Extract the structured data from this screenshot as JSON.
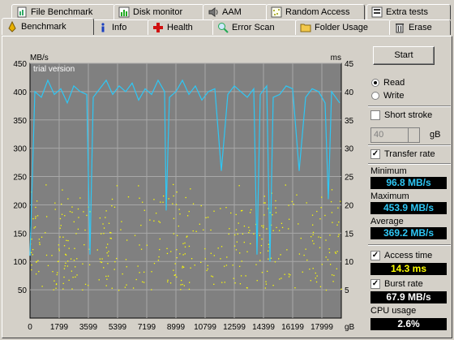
{
  "tabs_top": [
    {
      "label": "File Benchmark",
      "icon": "file-benchmark-icon"
    },
    {
      "label": "Disk monitor",
      "icon": "disk-monitor-icon"
    },
    {
      "label": "AAM",
      "icon": "speaker-icon"
    },
    {
      "label": "Random Access",
      "icon": "random-access-icon"
    },
    {
      "label": "Extra tests",
      "icon": "extra-tests-icon"
    }
  ],
  "tabs_bottom": [
    {
      "label": "Benchmark",
      "icon": "benchmark-icon"
    },
    {
      "label": "Info",
      "icon": "info-icon"
    },
    {
      "label": "Health",
      "icon": "health-cross-icon"
    },
    {
      "label": "Error Scan",
      "icon": "magnifier-icon"
    },
    {
      "label": "Folder Usage",
      "icon": "folder-icon"
    },
    {
      "label": "Erase",
      "icon": "trash-icon"
    }
  ],
  "controls": {
    "start_label": "Start",
    "read_label": "Read",
    "write_label": "Write",
    "mode_selected": "Read",
    "short_stroke_label": "Short stroke",
    "short_stroke_checked": false,
    "short_stroke_value": "40",
    "short_stroke_unit": "gB",
    "transfer_rate_label": "Transfer rate",
    "transfer_rate_checked": true,
    "access_time_label": "Access time",
    "access_time_checked": true,
    "burst_rate_label": "Burst rate",
    "burst_rate_checked": true
  },
  "stats": {
    "minimum_label": "Minimum",
    "minimum": "96.8 MB/s",
    "maximum_label": "Maximum",
    "maximum": "453.9 MB/s",
    "average_label": "Average",
    "average": "369.2 MB/s",
    "access_time": "14.3 ms",
    "burst_rate": "67.9 MB/s",
    "cpu_label": "CPU usage",
    "cpu_usage": "2.6%"
  },
  "colors": {
    "plot_bg": "#808080",
    "transfer_line": "#2ec7f5",
    "access_dots": "#ffff00",
    "value_bg": "#000000"
  },
  "chart_data": {
    "type": "line",
    "watermark": "trial version",
    "ylabel_left": "MB/s",
    "ylabel_right": "ms",
    "xlabel_unit": "gB",
    "xlim": [
      0,
      19199
    ],
    "ylim_left": [
      0,
      450
    ],
    "ylim_right": [
      0,
      45
    ],
    "x_ticks": [
      "0",
      "1799",
      "3599",
      "5399",
      "7199",
      "8999",
      "10799",
      "12599",
      "14399",
      "16199",
      "17999"
    ],
    "y_ticks_left": [
      "50",
      "100",
      "150",
      "200",
      "250",
      "300",
      "350",
      "400",
      "450"
    ],
    "y_ticks_right": [
      "5",
      "10",
      "15",
      "20",
      "25",
      "30",
      "35",
      "40",
      "45"
    ],
    "grid": true,
    "series": [
      {
        "name": "Transfer rate",
        "axis": "left",
        "x": [
          0,
          300,
          700,
          1100,
          1500,
          1900,
          2300,
          2700,
          3100,
          3500,
          3700,
          3900,
          4300,
          4700,
          5100,
          5500,
          5900,
          6300,
          6700,
          7100,
          7500,
          7900,
          8300,
          8400,
          8600,
          9000,
          9400,
          9800,
          10200,
          10600,
          11000,
          11400,
          11800,
          12200,
          12600,
          13000,
          13400,
          13800,
          14000,
          14200,
          14600,
          14800,
          15000,
          15400,
          15800,
          16200,
          16600,
          17000,
          17400,
          17800,
          18200,
          18400,
          18600,
          19100
        ],
        "y": [
          110,
          400,
          390,
          420,
          395,
          405,
          380,
          410,
          400,
          395,
          112,
          390,
          405,
          420,
          395,
          410,
          400,
          415,
          385,
          405,
          395,
          420,
          400,
          190,
          390,
          400,
          420,
          395,
          410,
          385,
          400,
          405,
          260,
          395,
          410,
          400,
          390,
          405,
          112,
          395,
          410,
          100,
          390,
          395,
          410,
          405,
          260,
          390,
          405,
          400,
          380,
          210,
          400,
          380
        ]
      }
    ],
    "access_time_ms": {
      "axis": "right",
      "range_ms": [
        5,
        25
      ],
      "typical_ms": 14.3
    }
  }
}
